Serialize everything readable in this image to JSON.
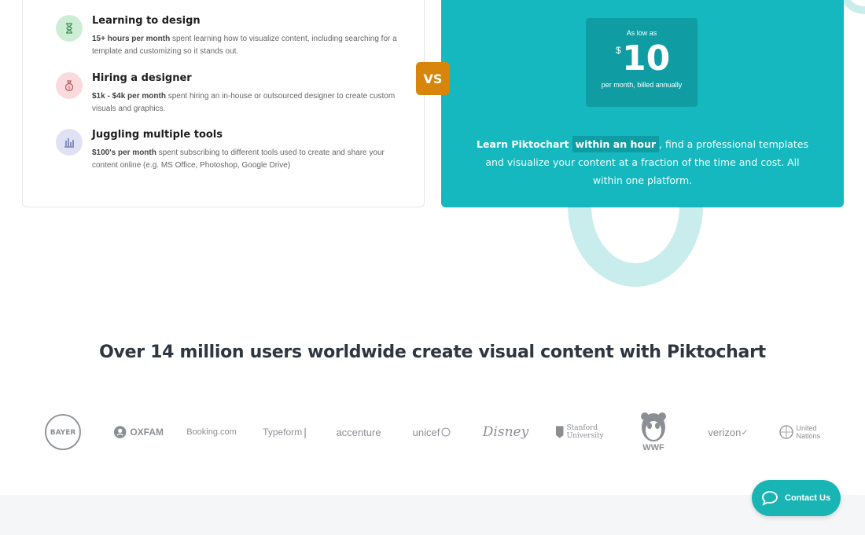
{
  "comparison": {
    "items": [
      {
        "icon": "hourglass-icon",
        "icon_bg": "#cdeed4",
        "title": "Learning to design",
        "highlight": "15+ hours per month",
        "desc": " spent learning how to visualize content, including searching for a template and customizing so it stands out."
      },
      {
        "icon": "money-bag-icon",
        "icon_bg": "#fbdadd",
        "title": "Hiring a designer",
        "highlight": "$1k - $4k per month",
        "desc": " spent hiring an in-house or outsourced designer to create custom visuals and graphics."
      },
      {
        "icon": "tools-chart-icon",
        "icon_bg": "#dfe2f5",
        "title": "Juggling multiple tools",
        "highlight": "$100's per month",
        "desc": " spent subscribing to different tools used to create and share your content online (e.g. MS Office, Photoshop, Google Drive)"
      }
    ],
    "vs_label": "VS"
  },
  "pricing": {
    "prefix": "As low as",
    "currency": "$",
    "amount": "10",
    "suffix": "per month, billed annually",
    "pitch_bold": "Learn Piktochart",
    "pitch_highlight": "within an hour",
    "pitch_rest": ", find a professional templates and visualize your content at a fraction of the time and cost. All within one platform."
  },
  "users": {
    "heading": "Over 14 million users worldwide create visual content with Piktochart",
    "logos": [
      "BAYER",
      "OXFAM",
      "Booking.com",
      "Typeform",
      "accenture",
      "unicef",
      "Disney",
      "Stanford University",
      "WWF",
      "verizon",
      "United Nations"
    ]
  },
  "contact": {
    "label": "Contact Us"
  },
  "colors": {
    "teal": "#14b8be",
    "teal_dark": "#0f9da3",
    "vs": "#d8860b",
    "ring": "#c9ecec"
  }
}
